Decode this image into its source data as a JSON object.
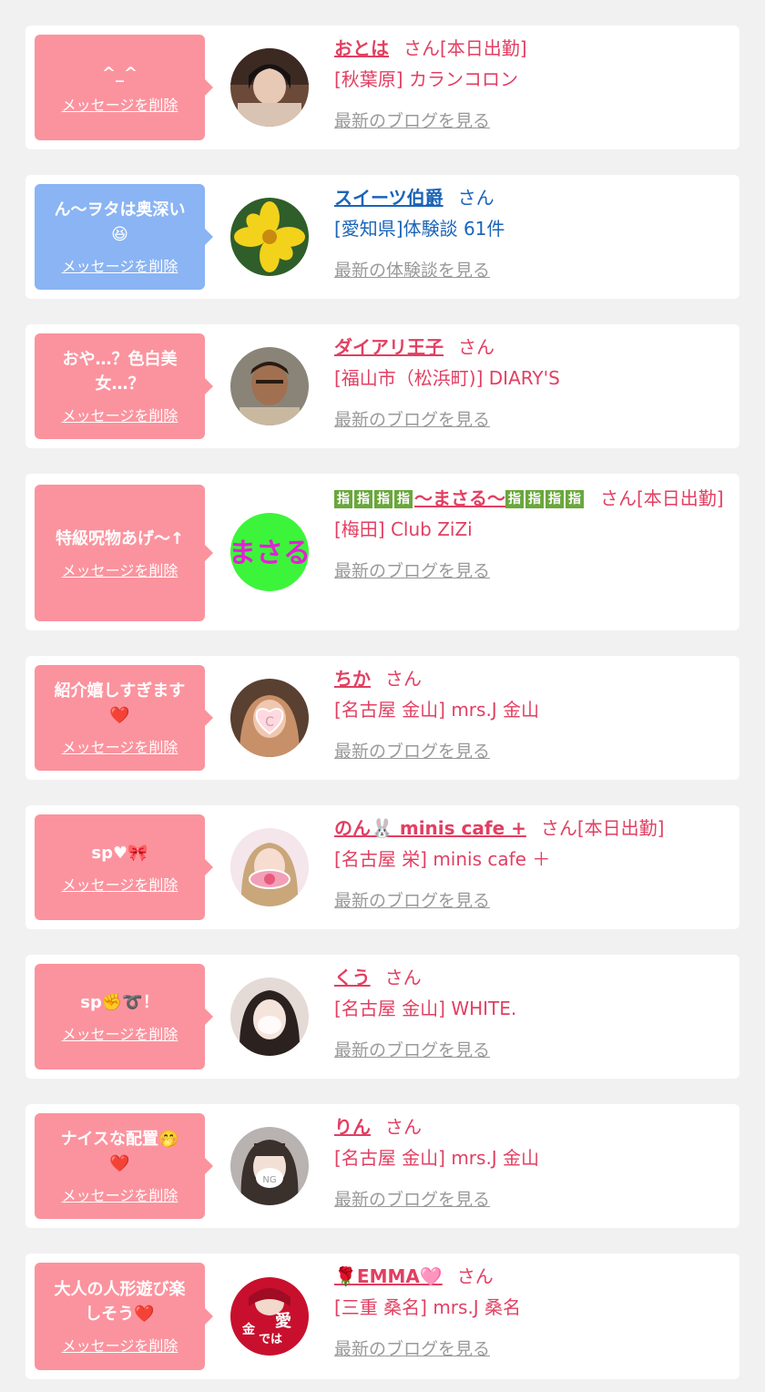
{
  "delete_label": "メッセージを削除",
  "cards": [
    {
      "message": "^_^",
      "name": "おとは",
      "san": "さん[本日出勤]",
      "shop": "[秋葉原] カランコロン",
      "blog": "最新のブログを見る"
    },
    {
      "message": "ん〜ヲタは奥深い\n😆",
      "name": "スイーツ伯爵",
      "san": "さん",
      "shop": "[愛知県]体験談 61件",
      "blog": "最新の体験談を見る"
    },
    {
      "message": "おや…？色白美\n女…？",
      "name": "ダイアリ王子",
      "san": "さん",
      "shop": "[福山市（松浜町)] DIARY'S",
      "blog": "最新のブログを見る"
    },
    {
      "message": "特級呪物あげ〜↑",
      "name_tag": "指",
      "name": "〜まさる〜",
      "san": "さん[本日出勤]",
      "shop": "[梅田] Club ZiZi",
      "blog": "最新のブログを見る"
    },
    {
      "message": "紹介嬉しすぎます\n❤️",
      "name": "ちか",
      "san": "さん",
      "shop": "[名古屋 金山] mrs.J 金山",
      "blog": "最新のブログを見る"
    },
    {
      "message": "sp♥🎀",
      "name": "のん🐰 minis cafe +",
      "san": "さん[本日出勤]",
      "shop": "[名古屋 栄] minis cafe ＋",
      "blog": "最新のブログを見る"
    },
    {
      "message": "sp✊➰！",
      "name": "くう",
      "san": "さん",
      "shop": "[名古屋 金山] WHITE.",
      "blog": "最新のブログを見る"
    },
    {
      "message": "ナイスな配置🤭\n❤️",
      "name": "りん",
      "san": "さん",
      "shop": "[名古屋 金山] mrs.J 金山",
      "blog": "最新のブログを見る"
    },
    {
      "message": "大人の人形遊び楽\nしそう❤️",
      "name": "🌹EMMA🩷",
      "san": "さん",
      "shop": "[三重 桑名] mrs.J 桑名",
      "blog": "最新のブログを見る"
    }
  ],
  "avatar_text": {
    "masaru": "まさる",
    "c": "C",
    "ng": "NG",
    "love": "愛",
    "kin": "金",
    "deha": "では"
  }
}
